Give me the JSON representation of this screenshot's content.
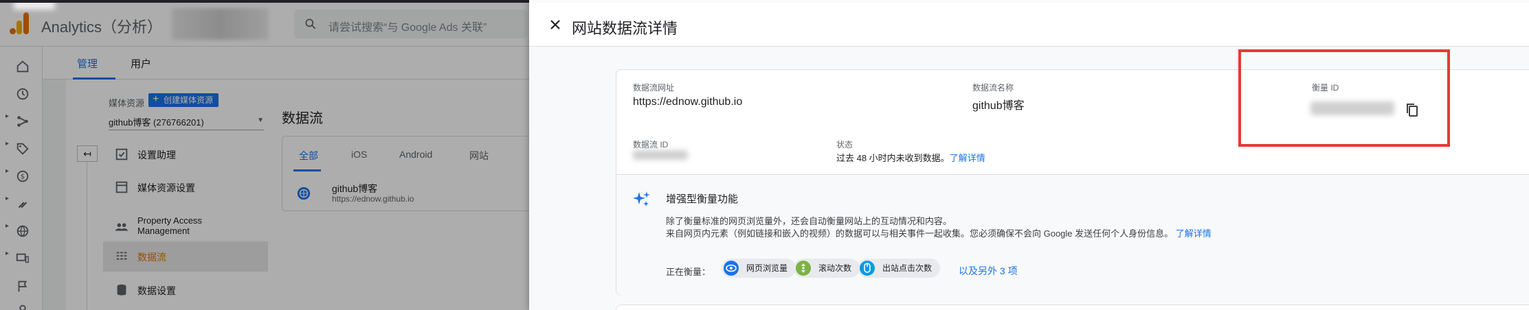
{
  "app": {
    "title": "Analytics（分析）"
  },
  "search": {
    "placeholder": "请尝试搜索“与 Google Ads 关联”"
  },
  "top_tabs": [
    {
      "label": "管理"
    },
    {
      "label": "用户"
    }
  ],
  "admin": {
    "property_label": "媒体资源",
    "create_button": "创建媒体资源",
    "property_selected": "github博客 (276766201)",
    "menu": [
      {
        "label": "设置助理"
      },
      {
        "label": "媒体资源设置"
      },
      {
        "label": "Property Access Management"
      },
      {
        "label": "数据流"
      },
      {
        "label": "数据设置"
      }
    ]
  },
  "data_streams": {
    "title": "数据流",
    "tabs": [
      {
        "label": "全部"
      },
      {
        "label": "iOS"
      },
      {
        "label": "Android"
      },
      {
        "label": "网站"
      }
    ],
    "row": {
      "name": "github博客",
      "url": "https://ednow.github.io"
    }
  },
  "drawer": {
    "title": "网站数据流详情",
    "stream_url_label": "数据流网址",
    "stream_url": "https://ednow.github.io",
    "stream_name_label": "数据流名称",
    "stream_name": "github博客",
    "measurement_id_label": "衡量 ID",
    "stream_id_label": "数据流 ID",
    "status_label": "状态",
    "status_text": "过去 48 小时内未收到数据。",
    "status_link": "了解详情",
    "enhanced": {
      "title": "增强型衡量功能",
      "desc_line1": "除了衡量标准的网页浏览量外，还会自动衡量网站上的互动情况和内容。",
      "desc_line2": "来自网页内元素（例如链接和嵌入的视频）的数据可以与相关事件一起收集。您必须确保不会向 Google 发送任何个人身份信息。",
      "desc_link": "了解详情",
      "measuring_label": "正在衡量：",
      "chips": [
        {
          "label": "网页浏览量",
          "icon": "eye-icon",
          "color": "#1a73e8"
        },
        {
          "label": "滚动次数",
          "icon": "scroll-icon",
          "color": "#7cb342"
        },
        {
          "label": "出站点击次数",
          "icon": "mouse-icon",
          "color": "#039be5"
        }
      ],
      "more_link": "以及另外 3 项"
    }
  },
  "colors": {
    "accent": "#1a73e8",
    "ga_orange": "#e37400",
    "highlight": "#e53935"
  }
}
